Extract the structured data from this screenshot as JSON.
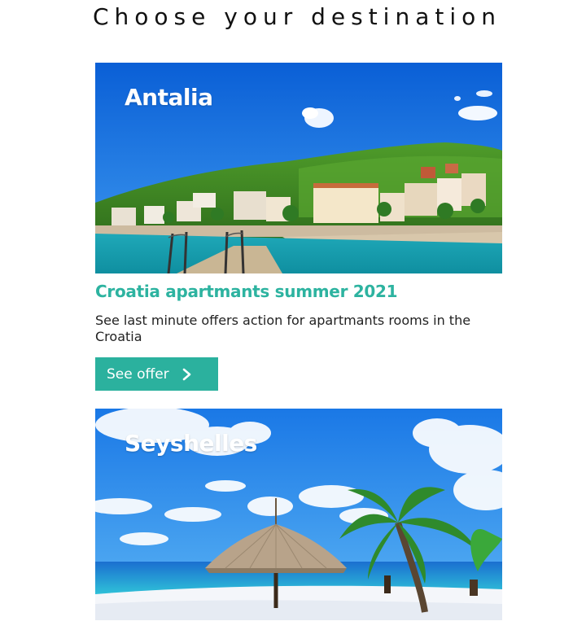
{
  "page": {
    "title": "Choose your destination"
  },
  "cards": [
    {
      "image_label": "Antalia",
      "title": "Croatia apartmants summer 2021",
      "description": "See last minute offers action for apartmants rooms in the Croatia",
      "button_label": "See offer",
      "button_icon": "chevron-right-icon"
    },
    {
      "image_label": "Seyshelles"
    }
  ],
  "colors": {
    "accent": "#2bb19e",
    "title_text": "#2db3a0"
  }
}
